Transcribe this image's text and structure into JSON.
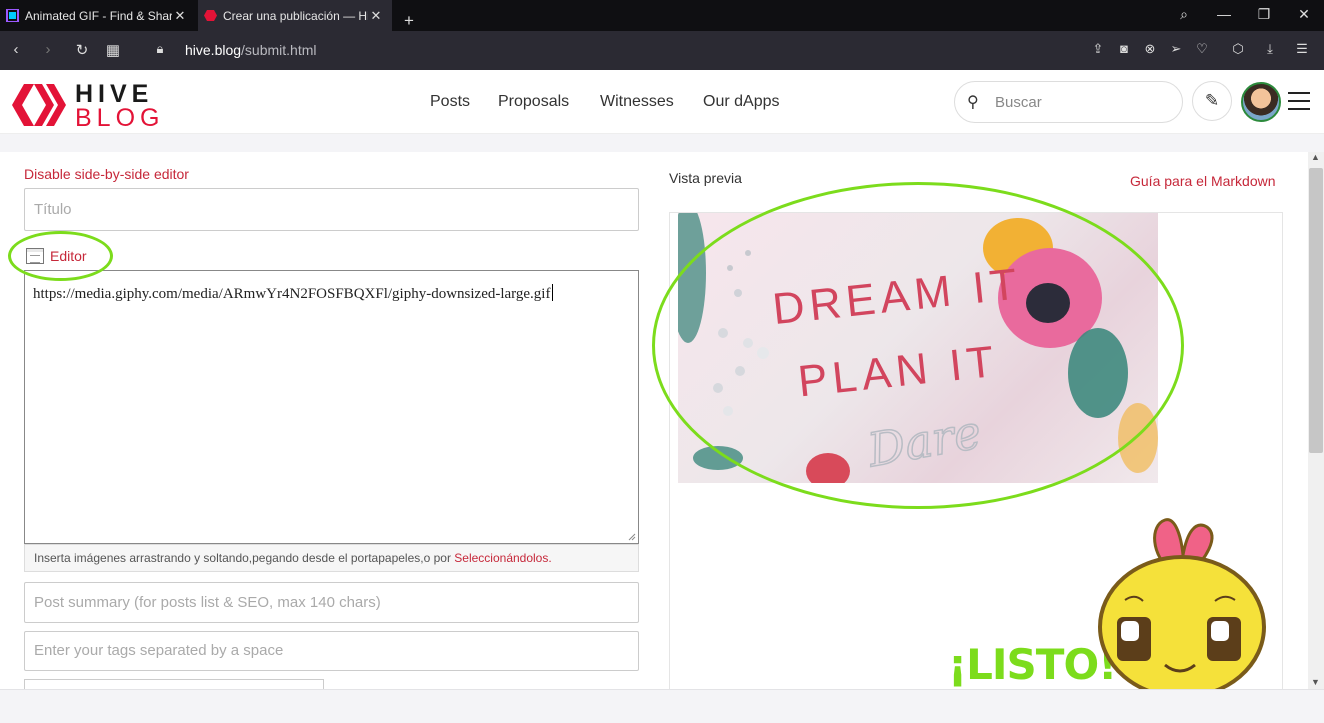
{
  "browser": {
    "tabs": [
      {
        "title": "Animated GIF - Find & Share",
        "favicon_color": "#9b59ff"
      },
      {
        "title": "Crear una publicación — Hive",
        "favicon_color": "#e31337"
      }
    ],
    "new_tab_icon": "plus-icon",
    "address": {
      "host": "hive.blog",
      "path": "/submit.html"
    }
  },
  "site": {
    "logo_top": "HIVE",
    "logo_bottom": "BLOG",
    "brand_color": "#e31337",
    "nav": [
      "Posts",
      "Proposals",
      "Witnesses",
      "Our dApps"
    ],
    "search_placeholder": "Buscar"
  },
  "editor": {
    "disable_side_by_side": "Disable side-by-side editor",
    "title_placeholder": "Título",
    "editor_tab_label": "Editor",
    "body_text": "https://media.giphy.com/media/ARmwYr4N2FOSFBQXFl/giphy-downsized-large.gif",
    "drop_note_prefix": "Inserta imágenes arrastrando y soltando,pegando desde el portapapeles,o por ",
    "drop_note_link": "Seleccionándolos.",
    "summary_placeholder": "Post summary (for posts list & SEO, max 140 chars)",
    "tags_placeholder": "Enter your tags separated by a space"
  },
  "preview": {
    "label": "Vista previa",
    "markdown_guide": "Guía para el Markdown",
    "gif_lines": [
      "DREAM IT",
      "PLAN IT"
    ],
    "gif_script_word": "Dare"
  },
  "annotation": {
    "listo": "¡LISTO!",
    "highlight_color": "#7cdc1c"
  }
}
